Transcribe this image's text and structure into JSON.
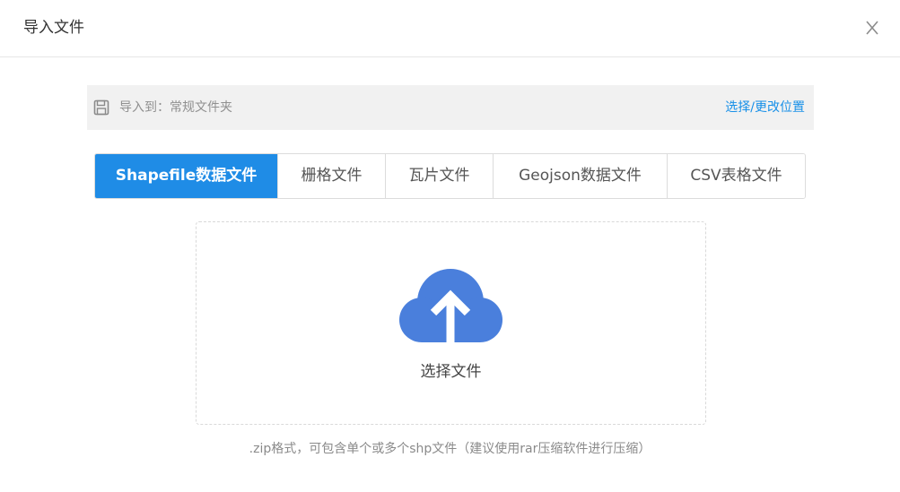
{
  "dialog": {
    "title": "导入文件",
    "close_label": "X"
  },
  "target": {
    "icon": "floppy-disk-icon",
    "label": "导入到：常规文件夹",
    "change_link": "选择/更改位置"
  },
  "tabs": [
    {
      "label": "Shapefile数据文件",
      "active": true
    },
    {
      "label": "栅格文件",
      "active": false
    },
    {
      "label": "瓦片文件",
      "active": false
    },
    {
      "label": "Geojson数据文件",
      "active": false
    },
    {
      "label": "CSV表格文件",
      "active": false
    }
  ],
  "dropzone": {
    "icon": "cloud-upload-icon",
    "label": "选择文件"
  },
  "hint": ".zip格式，可包含单个或多个shp文件（建议使用rar压缩软件进行压缩）",
  "colors": {
    "accent": "#1f8ce6",
    "link": "#1890e8",
    "upload_icon": "#4a7fdc",
    "bar_bg": "#f1f1f1"
  }
}
